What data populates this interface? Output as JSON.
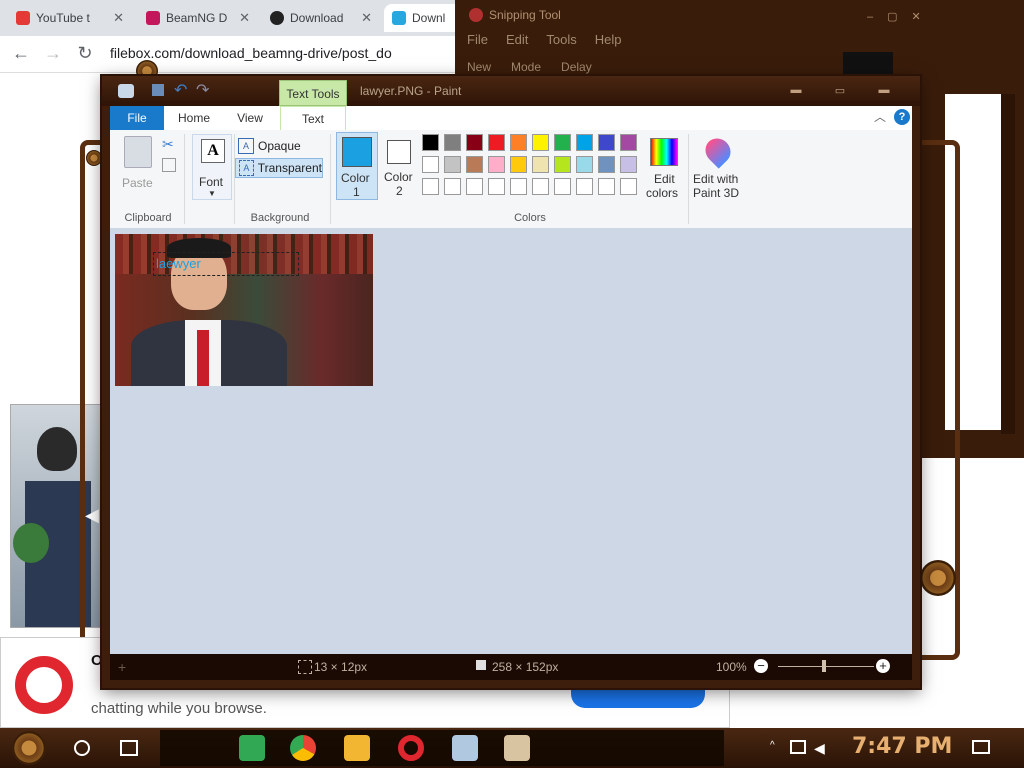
{
  "browser": {
    "tabs": [
      {
        "label": "YouTube t",
        "icon": "youtube-icon",
        "color": "#e53935"
      },
      {
        "label": "BeamNG D",
        "icon": "gamepad-icon",
        "color": "#c2185b"
      },
      {
        "label": "Download",
        "icon": "a-logo-icon",
        "color": "#222222"
      },
      {
        "label": "Downl",
        "icon": "filebox-icon",
        "color": "#29a8e0"
      }
    ],
    "url": "filebox.com/download_beamng-drive/post_do",
    "close_symbol": "✕"
  },
  "snipping_tool": {
    "title": "Snipping Tool",
    "menu": [
      "File",
      "Edit",
      "Tools",
      "Help"
    ],
    "buttons": [
      "New",
      "Mode",
      "Delay"
    ]
  },
  "paint": {
    "title": "lawyer.PNG - Paint",
    "context_tab": "Text Tools",
    "tabs": [
      "File",
      "Home",
      "View",
      "Text"
    ],
    "clipboard": {
      "paste": "Paste",
      "group": "Clipboard"
    },
    "font": {
      "label": "Font",
      "icon_letter": "A"
    },
    "background": {
      "opaque": "Opaque",
      "transparent": "Transparent",
      "group": "Background"
    },
    "colors": {
      "color1": "Color\n1",
      "color1_label": "Color",
      "color1_num": "1",
      "color2_label": "Color",
      "color2_num": "2",
      "edit_colors_1": "Edit",
      "edit_colors_2": "colors",
      "edit3d_1": "Edit with",
      "edit3d_2": "Paint 3D",
      "group": "Colors",
      "color1_value": "#1ba1e2",
      "color2_value": "#ffffff",
      "palette_row1": [
        "#000000",
        "#7f7f7f",
        "#880015",
        "#ed1c24",
        "#ff7f27",
        "#fff200",
        "#22b14c",
        "#00a2e8",
        "#3f48cc",
        "#a349a4"
      ],
      "palette_row2": [
        "#ffffff",
        "#c3c3c3",
        "#b97a57",
        "#ffaec9",
        "#ffc90e",
        "#efe4b0",
        "#b5e61d",
        "#99d9ea",
        "#7092be",
        "#c8bfe7"
      ]
    },
    "textbox_value": "laewyer",
    "status": {
      "selection": "13 × 12px",
      "size": "258 × 152px",
      "zoom": "100%"
    }
  },
  "notification": {
    "heading": "O",
    "body": "chatting while you browse."
  },
  "taskbar": {
    "time": "7:47 PM"
  }
}
